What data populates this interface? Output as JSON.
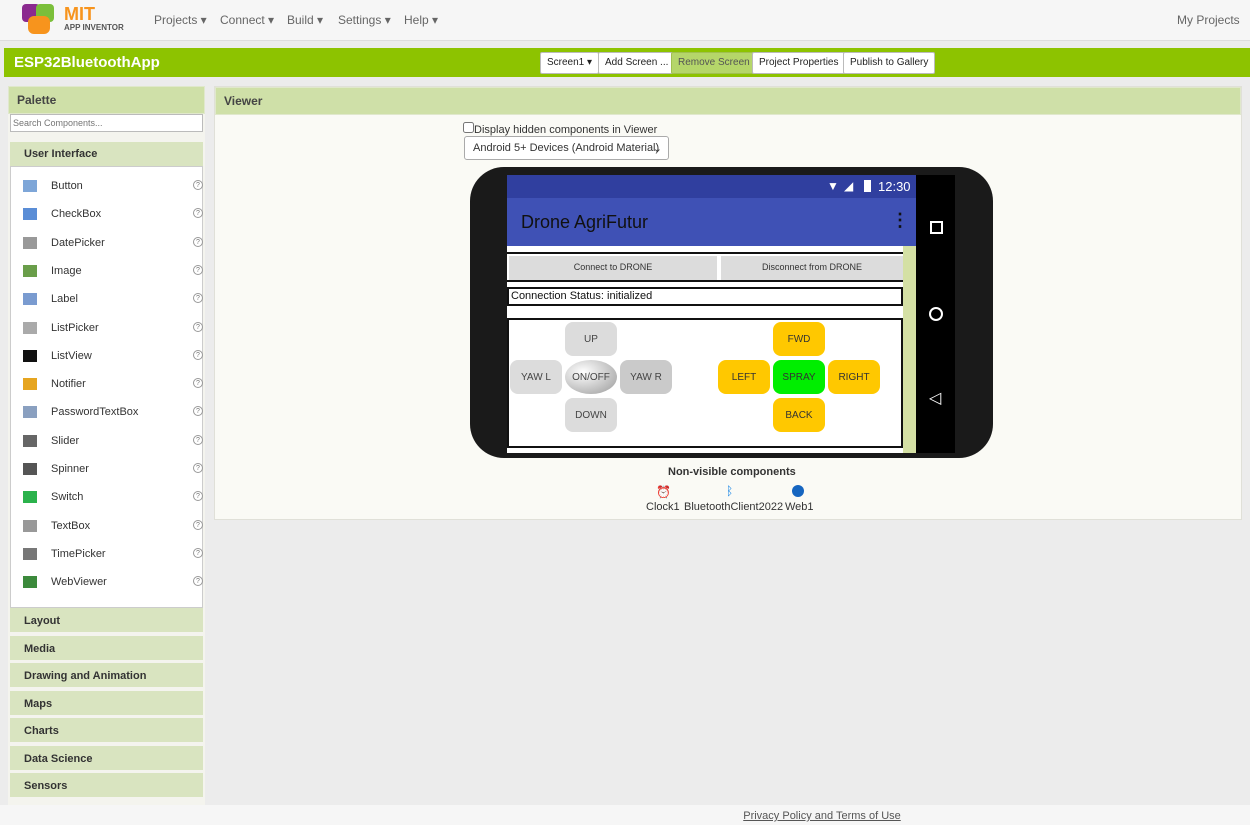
{
  "topbar": {
    "logo_title": "MIT",
    "logo_sub": "APP INVENTOR",
    "menus": [
      "Projects ▾",
      "Connect ▾",
      "Build ▾",
      "Settings ▾",
      "Help ▾"
    ],
    "my_projects": "My Projects"
  },
  "project": {
    "name": "ESP32BluetoothApp",
    "screen_select": "Screen1 ▾",
    "add_screen": "Add Screen ...",
    "remove_screen": "Remove Screen",
    "properties": "Project Properties",
    "publish": "Publish to Gallery"
  },
  "palette": {
    "title": "Palette",
    "search_placeholder": "Search Components...",
    "open_category": "User Interface",
    "items": [
      "Button",
      "CheckBox",
      "DatePicker",
      "Image",
      "Label",
      "ListPicker",
      "ListView",
      "Notifier",
      "PasswordTextBox",
      "Slider",
      "Spinner",
      "Switch",
      "TextBox",
      "TimePicker",
      "WebViewer"
    ],
    "categories": [
      "Layout",
      "Media",
      "Drawing and Animation",
      "Maps",
      "Charts",
      "Data Science",
      "Sensors"
    ]
  },
  "viewer": {
    "title": "Viewer",
    "hidden_label": "Display hidden components in Viewer",
    "device": "Android 5+ Devices (Android Material)",
    "phone": {
      "time": "12:30",
      "app_title": "Drone AgriFutur",
      "connect": "Connect to DRONE",
      "disconnect": "Disconnect from DRONE",
      "status": "Connection Status: initialized",
      "buttons": {
        "up": "UP",
        "down": "DOWN",
        "yaw_l": "YAW L",
        "yaw_r": "YAW R",
        "onoff": "ON/OFF",
        "fwd": "FWD",
        "back": "BACK",
        "left": "LEFT",
        "right": "RIGHT",
        "spray": "SPRAY"
      }
    },
    "nonvisible_title": "Non-visible components",
    "nonvisible": [
      "Clock1",
      "BluetoothClient2022",
      "Web1"
    ]
  },
  "footer": {
    "privacy": "Privacy Policy and Terms of Use"
  },
  "colors": {
    "green": "#8dc300",
    "appbar": "#3f51b5",
    "statusbar": "#303f9f",
    "yellow": "#ffc800",
    "spray": "#00ee00"
  }
}
